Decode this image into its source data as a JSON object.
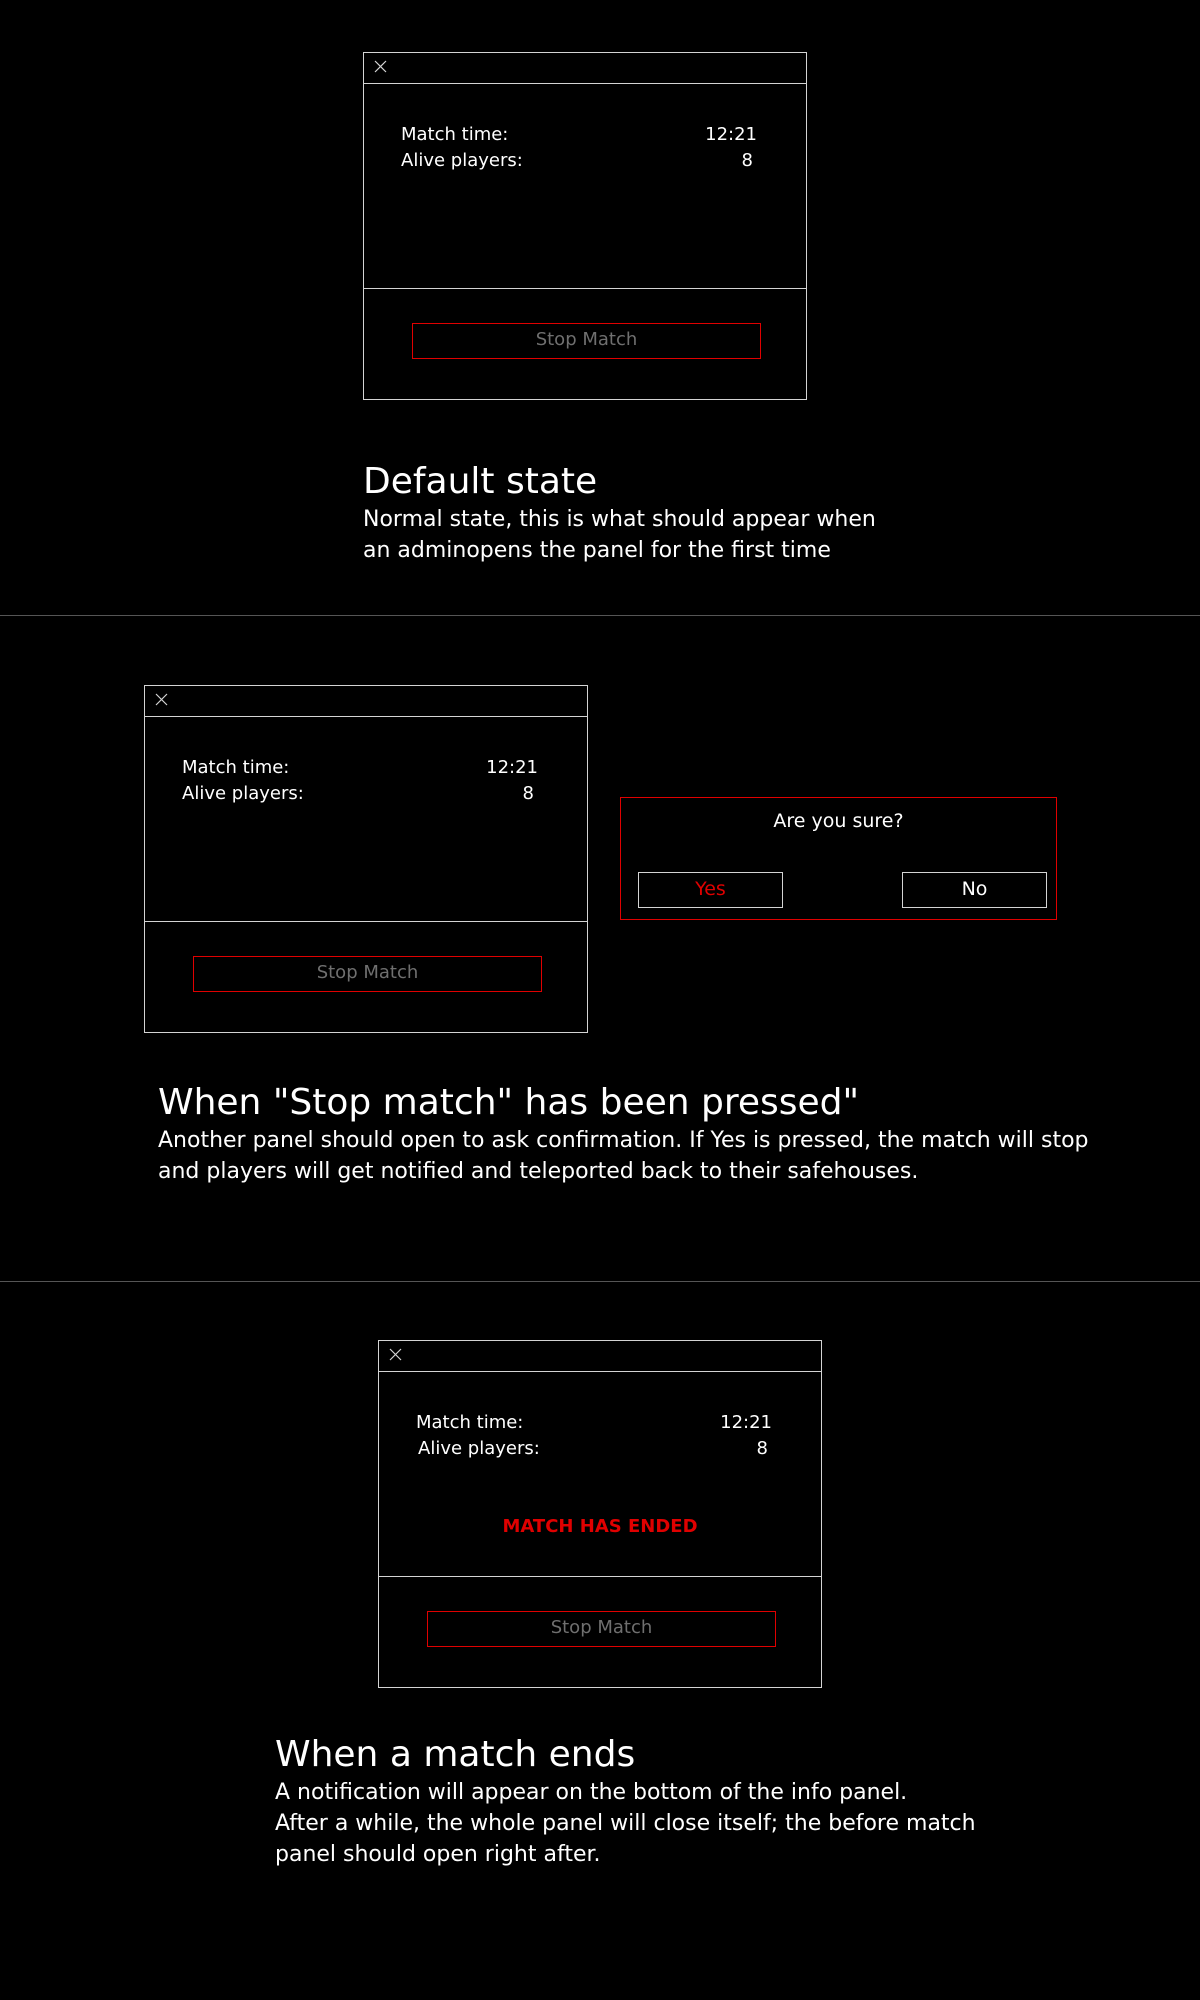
{
  "panel": {
    "match_time_label": "Match time:",
    "match_time_value": "12:21",
    "alive_players_label": "Alive players:",
    "alive_players_value": "8",
    "stop_button_label": "Stop Match",
    "close_icon": "close-icon"
  },
  "section1": {
    "title": "Default state",
    "description_lines": [
      "Normal state, this is what should appear when",
      "an adminopens the panel for the first time"
    ]
  },
  "section2": {
    "title": "When \"Stop match\" has been pressed\"",
    "description_lines": [
      "Another panel should open to ask confirmation. If Yes is pressed, the match will stop",
      "and players will get notified and teleported back to their safehouses."
    ],
    "confirm": {
      "question": "Are you sure?",
      "yes_label": "Yes",
      "no_label": "No"
    }
  },
  "section3": {
    "title": "When a match ends",
    "ended_label": "MATCH HAS ENDED",
    "description_lines": [
      "A notification will appear on the bottom of the info panel.",
      "After a while, the whole panel will close itself; the before match",
      "panel should open right after."
    ]
  },
  "colors": {
    "background": "#000000",
    "accent_red": "#e00000",
    "border": "#d4d4d4",
    "muted_text": "#6f6f6f"
  }
}
